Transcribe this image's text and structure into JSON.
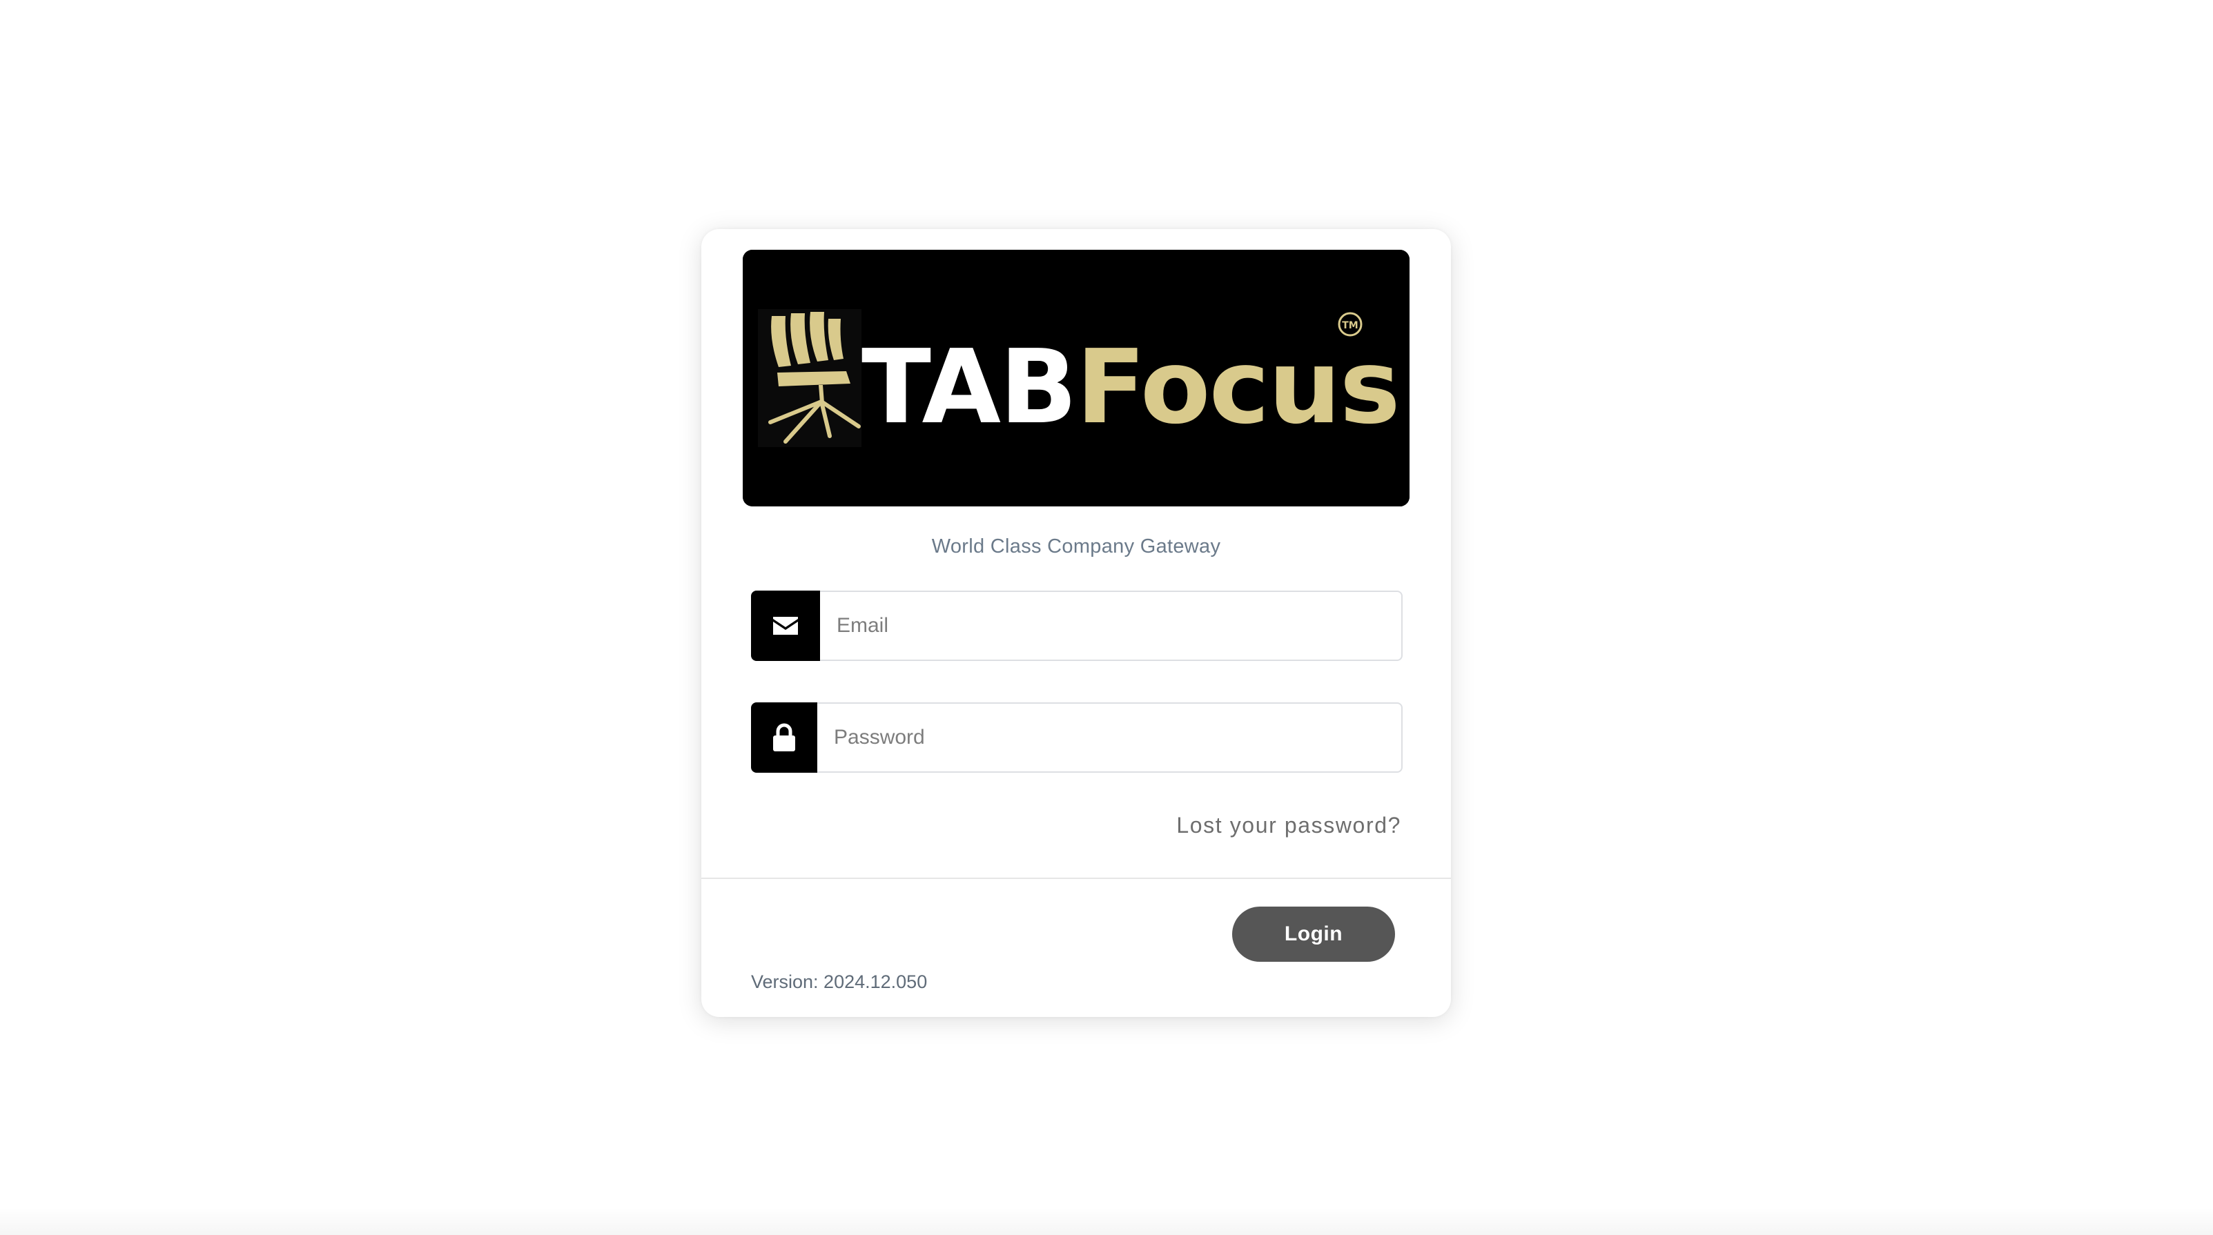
{
  "logo": {
    "text_white": "TAB",
    "text_gold": "Focus",
    "trademark": "TM",
    "colors": {
      "background": "#000000",
      "white": "#ffffff",
      "gold": "#d9ca8c"
    },
    "icon": "office-chair-icon"
  },
  "tagline": "World Class Company Gateway",
  "form": {
    "email": {
      "icon": "envelope-icon",
      "placeholder": "Email",
      "value": ""
    },
    "password": {
      "icon": "lock-icon",
      "placeholder": "Password",
      "value": ""
    },
    "lost_password_label": "Lost your password?",
    "login_label": "Login"
  },
  "footer": {
    "version_text": "Version: 2024.12.050"
  },
  "colors": {
    "login_button": "#565656",
    "addon_background": "#000000",
    "tagline": "#6b7a8a"
  }
}
